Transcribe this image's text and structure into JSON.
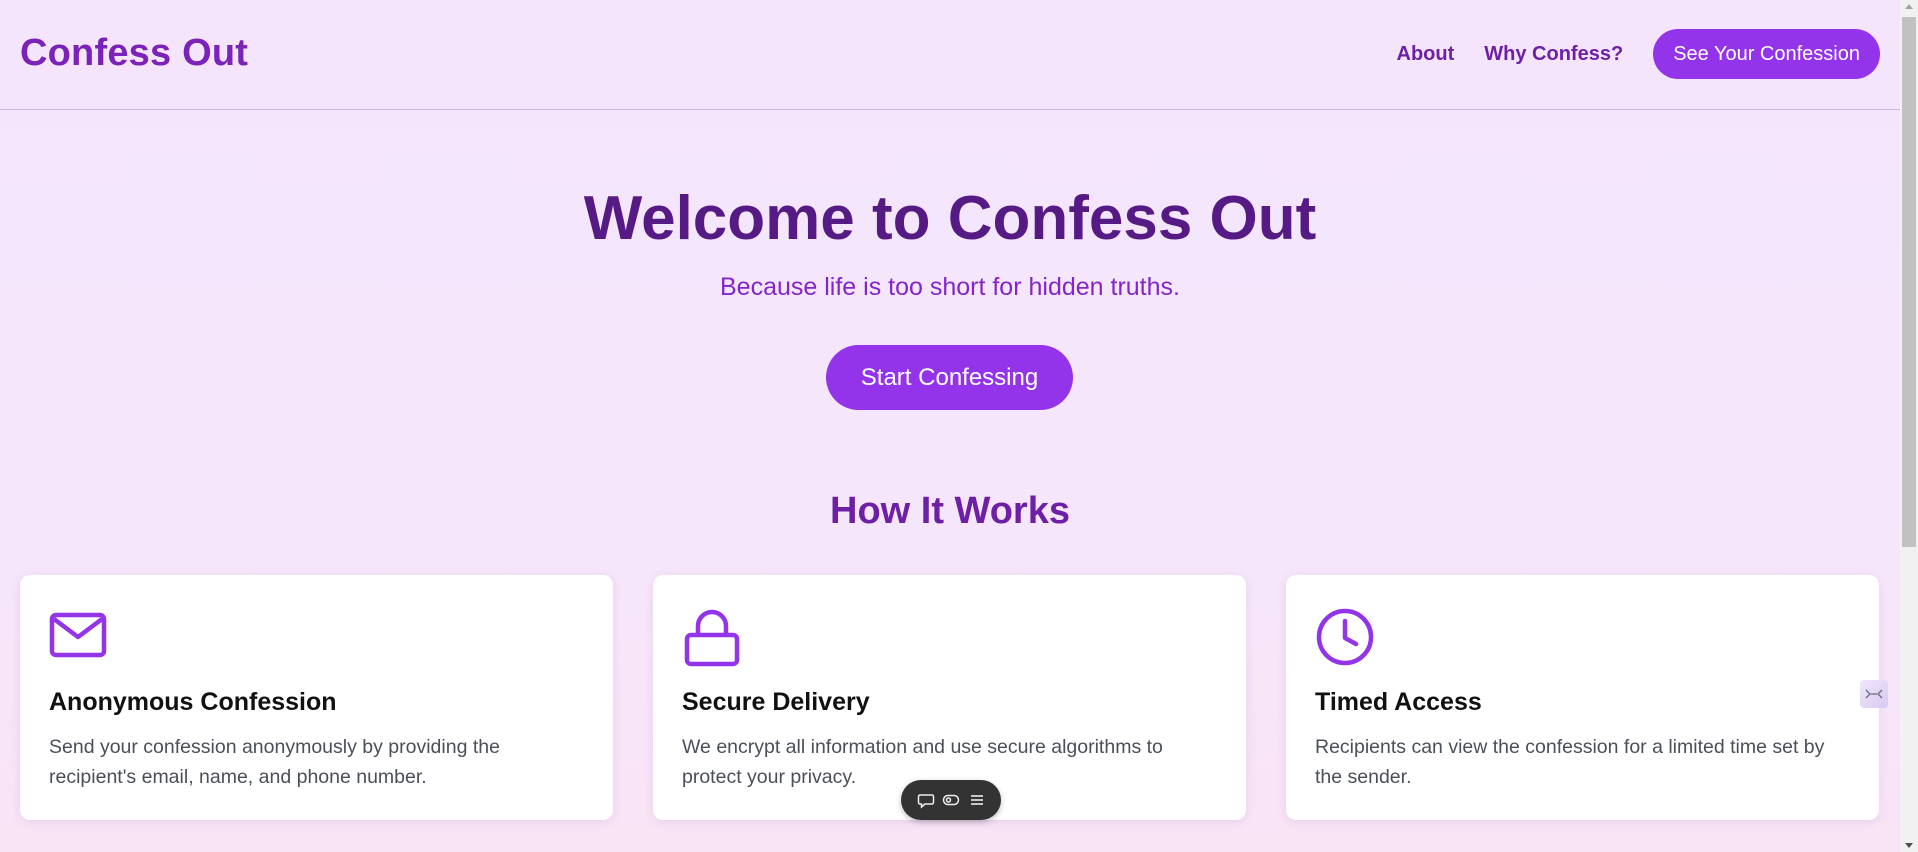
{
  "header": {
    "brand": "Confess Out",
    "nav": [
      {
        "label": "About"
      },
      {
        "label": "Why Confess?"
      }
    ],
    "cta_label": "See Your Confession"
  },
  "hero": {
    "title": "Welcome to Confess Out",
    "subtitle": "Because life is too short for hidden truths.",
    "cta_label": "Start Confessing"
  },
  "how_it_works": {
    "title": "How It Works",
    "cards": [
      {
        "icon": "envelope-icon",
        "title": "Anonymous Confession",
        "text": "Send your confession anonymously by providing the recipient's email, name, and phone number."
      },
      {
        "icon": "lock-icon",
        "title": "Secure Delivery",
        "text": "We encrypt all information and use secure algorithms to protect your privacy."
      },
      {
        "icon": "clock-icon",
        "title": "Timed Access",
        "text": "Recipients can view the confession for a limited time set by the sender."
      }
    ]
  },
  "floating_toolbar": {
    "icons": [
      "comment-icon",
      "toggle-icon",
      "menu-icon"
    ]
  },
  "colors": {
    "accent": "#9333ea",
    "brand": "#7b22b8",
    "hero_title": "#561a85",
    "background": "#f5e5fc"
  }
}
